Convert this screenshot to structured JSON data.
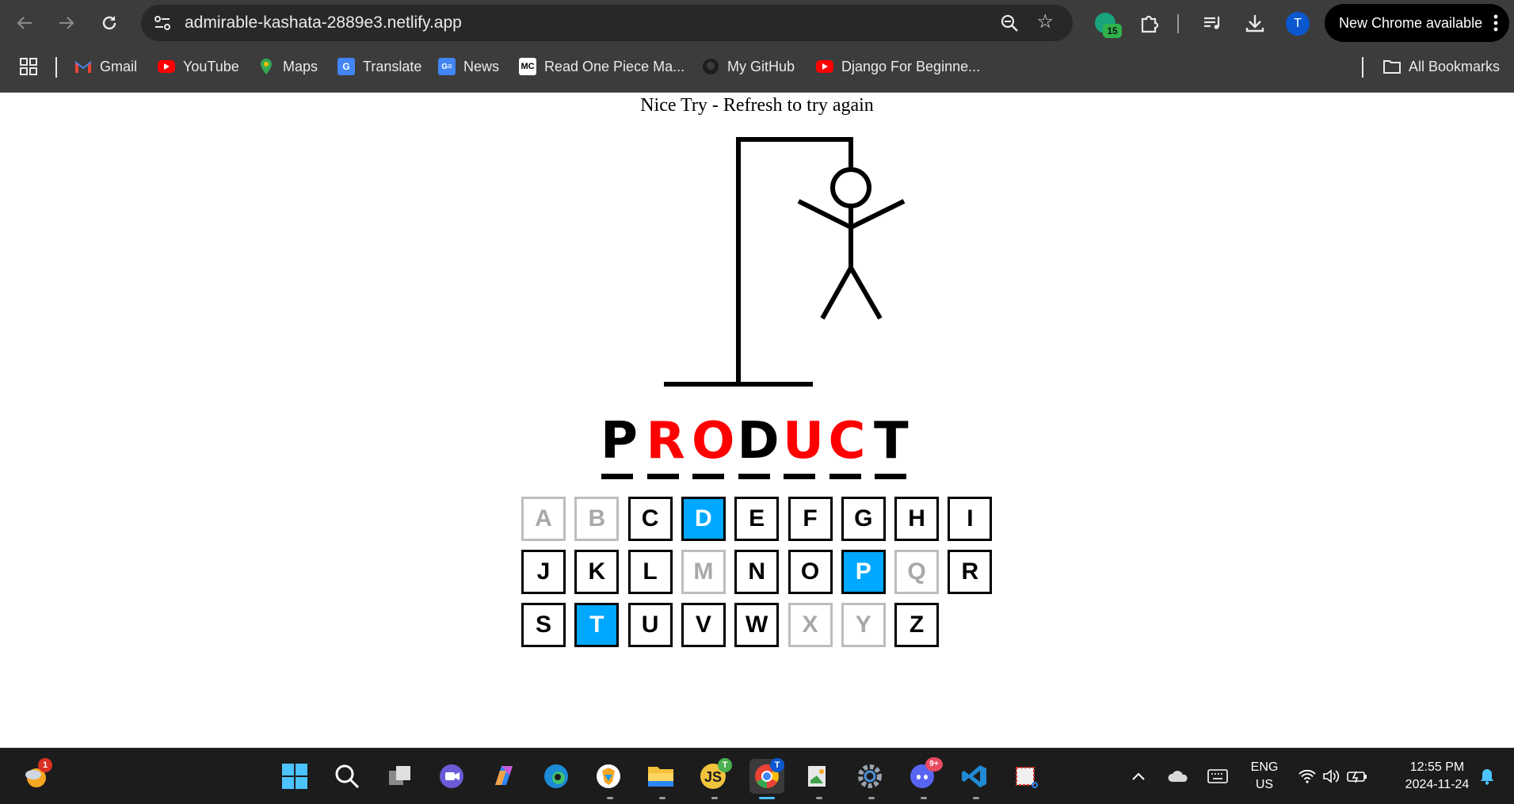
{
  "browser": {
    "url": "admirable-kashata-2889e3.netlify.app",
    "extension_count": "15",
    "profile_initial": "T",
    "update_label": "New Chrome available"
  },
  "bookmarks": {
    "items": [
      {
        "label": "Gmail",
        "icon": "gmail-icon"
      },
      {
        "label": "YouTube",
        "icon": "youtube-icon"
      },
      {
        "label": "Maps",
        "icon": "maps-icon"
      },
      {
        "label": "Translate",
        "icon": "translate-icon"
      },
      {
        "label": "News",
        "icon": "news-icon"
      },
      {
        "label": "Read One Piece Ma...",
        "icon": "mc-icon",
        "icon_text": "MC"
      },
      {
        "label": "My GitHub",
        "icon": "github-icon"
      },
      {
        "label": "Django For Beginne...",
        "icon": "youtube-icon"
      }
    ],
    "all_bookmarks": "All Bookmarks"
  },
  "game": {
    "status": "Nice Try - Refresh to try again",
    "word": [
      {
        "ch": "P",
        "color": "#000000"
      },
      {
        "ch": "R",
        "color": "#ff0000"
      },
      {
        "ch": "O",
        "color": "#ff0000"
      },
      {
        "ch": "D",
        "color": "#000000"
      },
      {
        "ch": "U",
        "color": "#ff0000"
      },
      {
        "ch": "C",
        "color": "#ff0000"
      },
      {
        "ch": "T",
        "color": "#000000"
      }
    ],
    "keys": [
      {
        "k": "A",
        "state": "used"
      },
      {
        "k": "B",
        "state": "used"
      },
      {
        "k": "C",
        "state": "normal"
      },
      {
        "k": "D",
        "state": "active"
      },
      {
        "k": "E",
        "state": "normal"
      },
      {
        "k": "F",
        "state": "normal"
      },
      {
        "k": "G",
        "state": "normal"
      },
      {
        "k": "H",
        "state": "normal"
      },
      {
        "k": "I",
        "state": "normal"
      },
      {
        "k": "J",
        "state": "normal"
      },
      {
        "k": "K",
        "state": "normal"
      },
      {
        "k": "L",
        "state": "normal"
      },
      {
        "k": "M",
        "state": "used"
      },
      {
        "k": "N",
        "state": "normal"
      },
      {
        "k": "O",
        "state": "normal"
      },
      {
        "k": "P",
        "state": "active"
      },
      {
        "k": "Q",
        "state": "used"
      },
      {
        "k": "R",
        "state": "normal"
      },
      {
        "k": "S",
        "state": "normal"
      },
      {
        "k": "T",
        "state": "active"
      },
      {
        "k": "U",
        "state": "normal"
      },
      {
        "k": "V",
        "state": "normal"
      },
      {
        "k": "W",
        "state": "normal"
      },
      {
        "k": "X",
        "state": "used"
      },
      {
        "k": "Y",
        "state": "used"
      },
      {
        "k": "Z",
        "state": "normal"
      }
    ],
    "colors": {
      "active": "#00a8ff",
      "missed": "#ff0000",
      "used": "#a8a8a8"
    }
  },
  "taskbar": {
    "weather_badge": "1",
    "js_badge": "T",
    "chrome_badge": "T",
    "discord_badge": "9+",
    "lang_line1": "ENG",
    "lang_line2": "US",
    "time": "12:55 PM",
    "date": "2024-11-24"
  }
}
